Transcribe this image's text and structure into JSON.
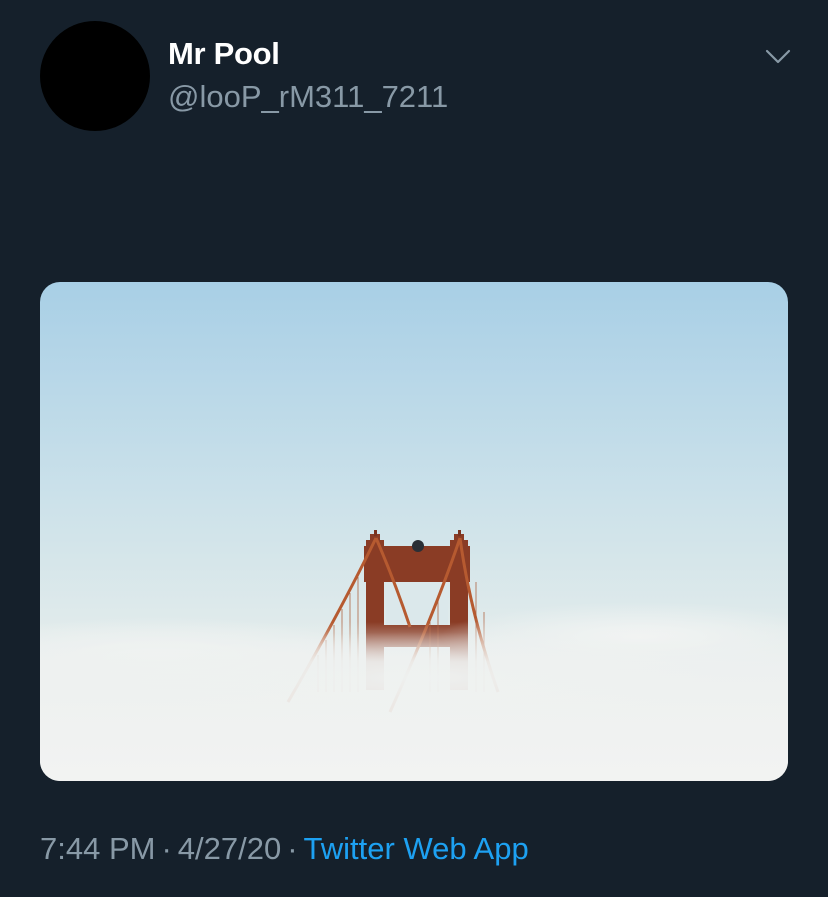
{
  "tweet": {
    "author": {
      "display_name": "Mr Pool",
      "handle": "@looP_rM311_7211"
    },
    "media": {
      "alt": ""
    },
    "meta": {
      "time": "7:44 PM",
      "separator": "·",
      "date": "4/27/20",
      "source": "Twitter Web App"
    }
  },
  "icons": {
    "menu": "chevron-down-icon"
  },
  "colors": {
    "background": "#15202b",
    "primary_text": "#ffffff",
    "secondary_text": "#8899a6",
    "link": "#1da1f2",
    "avatar": "#000000"
  }
}
